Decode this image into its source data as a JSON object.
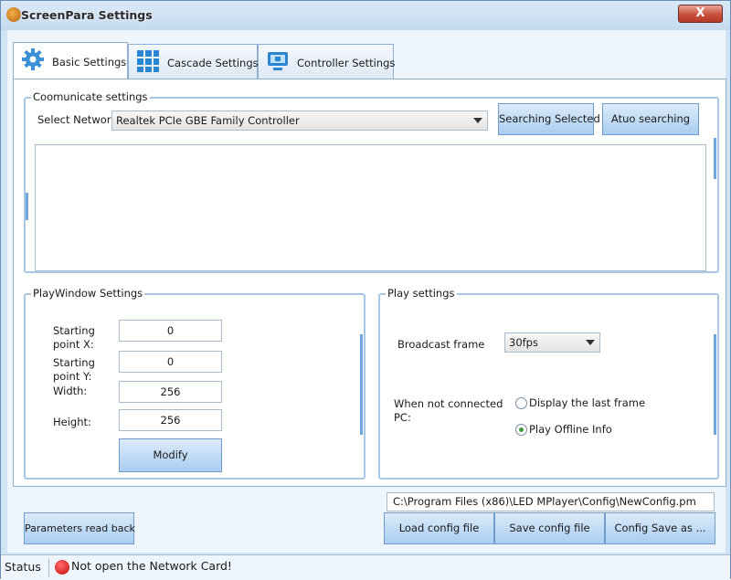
{
  "window": {
    "title": "ScreenPara Settings",
    "close_label": "X"
  },
  "tabs": [
    {
      "label": "Basic Settings",
      "icon": "gear-icon",
      "active": true
    },
    {
      "label": "Cascade Settings",
      "icon": "grid-icon",
      "active": false
    },
    {
      "label": "Controller Settings",
      "icon": "monitor-icon",
      "active": false
    }
  ],
  "communicate": {
    "title": "Coomunicate settings",
    "select_network_label": "Select Network",
    "network_value": "Realtek PCIe GBE Family Controller",
    "search_selected_label": "Searching Selected",
    "auto_search_label": "Atuo searching"
  },
  "playwindow": {
    "title": "PlayWindow Settings",
    "start_x_label": "Starting point X:",
    "start_x_value": "0",
    "start_y_label": "Starting point Y:",
    "start_y_value": "0",
    "width_label": "Width:",
    "width_value": "256",
    "height_label": "Height:",
    "height_value": "256",
    "modify_label": "Modify"
  },
  "play": {
    "title": "Play settings",
    "broadcast_label": "Broadcast frame",
    "broadcast_value": "30fps",
    "not_connected_label": "When not connected PC:",
    "option_last_frame": "Display the last frame",
    "option_offline": "Play Offline Info",
    "selected_option": "Play Offline Info"
  },
  "bottom": {
    "params_readback_label": "Parameters read back",
    "config_path": "C:\\Program Files (x86)\\LED MPlayer\\Config\\NewConfig.pm",
    "load_label": "Load config file",
    "save_label": "Save config file",
    "save_as_label": "Config Save as ..."
  },
  "statusbar": {
    "label": "Status",
    "message": "Not open the Network Card!",
    "status_color": "#d01010"
  },
  "colors": {
    "accent": "#a9cdf1",
    "border": "#6f9ccd"
  }
}
